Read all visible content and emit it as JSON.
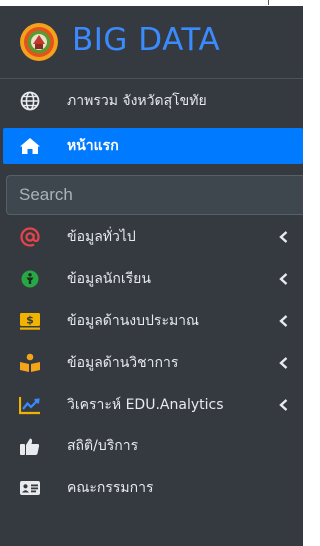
{
  "brand": {
    "title": "BIG DATA",
    "logo_icon": "seal-logo-icon"
  },
  "nav": {
    "overview": {
      "label": "ภาพรวม จังหวัดสุโขทัย",
      "icon": "globe-icon"
    },
    "home": {
      "label": "หน้าแรก",
      "icon": "home-icon"
    },
    "search": {
      "placeholder": "Search"
    },
    "items": [
      {
        "label": "ข้อมูลทั่วไป",
        "icon": "at-sign-icon",
        "has_submenu": true
      },
      {
        "label": "ข้อมูลนักเรียน",
        "icon": "student-icon",
        "has_submenu": true
      },
      {
        "label": "ข้อมูลด้านงบประมาณ",
        "icon": "money-icon",
        "has_submenu": true
      },
      {
        "label": "ข้อมูลด้านวิชาการ",
        "icon": "book-reader-icon",
        "has_submenu": true
      },
      {
        "label": "วิเคราะห์ EDU.Analytics",
        "icon": "chart-line-icon",
        "has_submenu": true
      },
      {
        "label": "สถิติ/บริการ",
        "icon": "thumbs-up-icon",
        "has_submenu": false
      },
      {
        "label": "คณะกรรมการ",
        "icon": "id-card-icon",
        "has_submenu": false
      }
    ]
  },
  "colors": {
    "sidebar_bg": "#343a40",
    "active_bg": "#007bff",
    "brand_text": "#3b8bff",
    "icon_red": "#e8434b",
    "icon_green": "#28a745",
    "icon_yellow": "#f0b400",
    "icon_orange": "#f5a318"
  }
}
